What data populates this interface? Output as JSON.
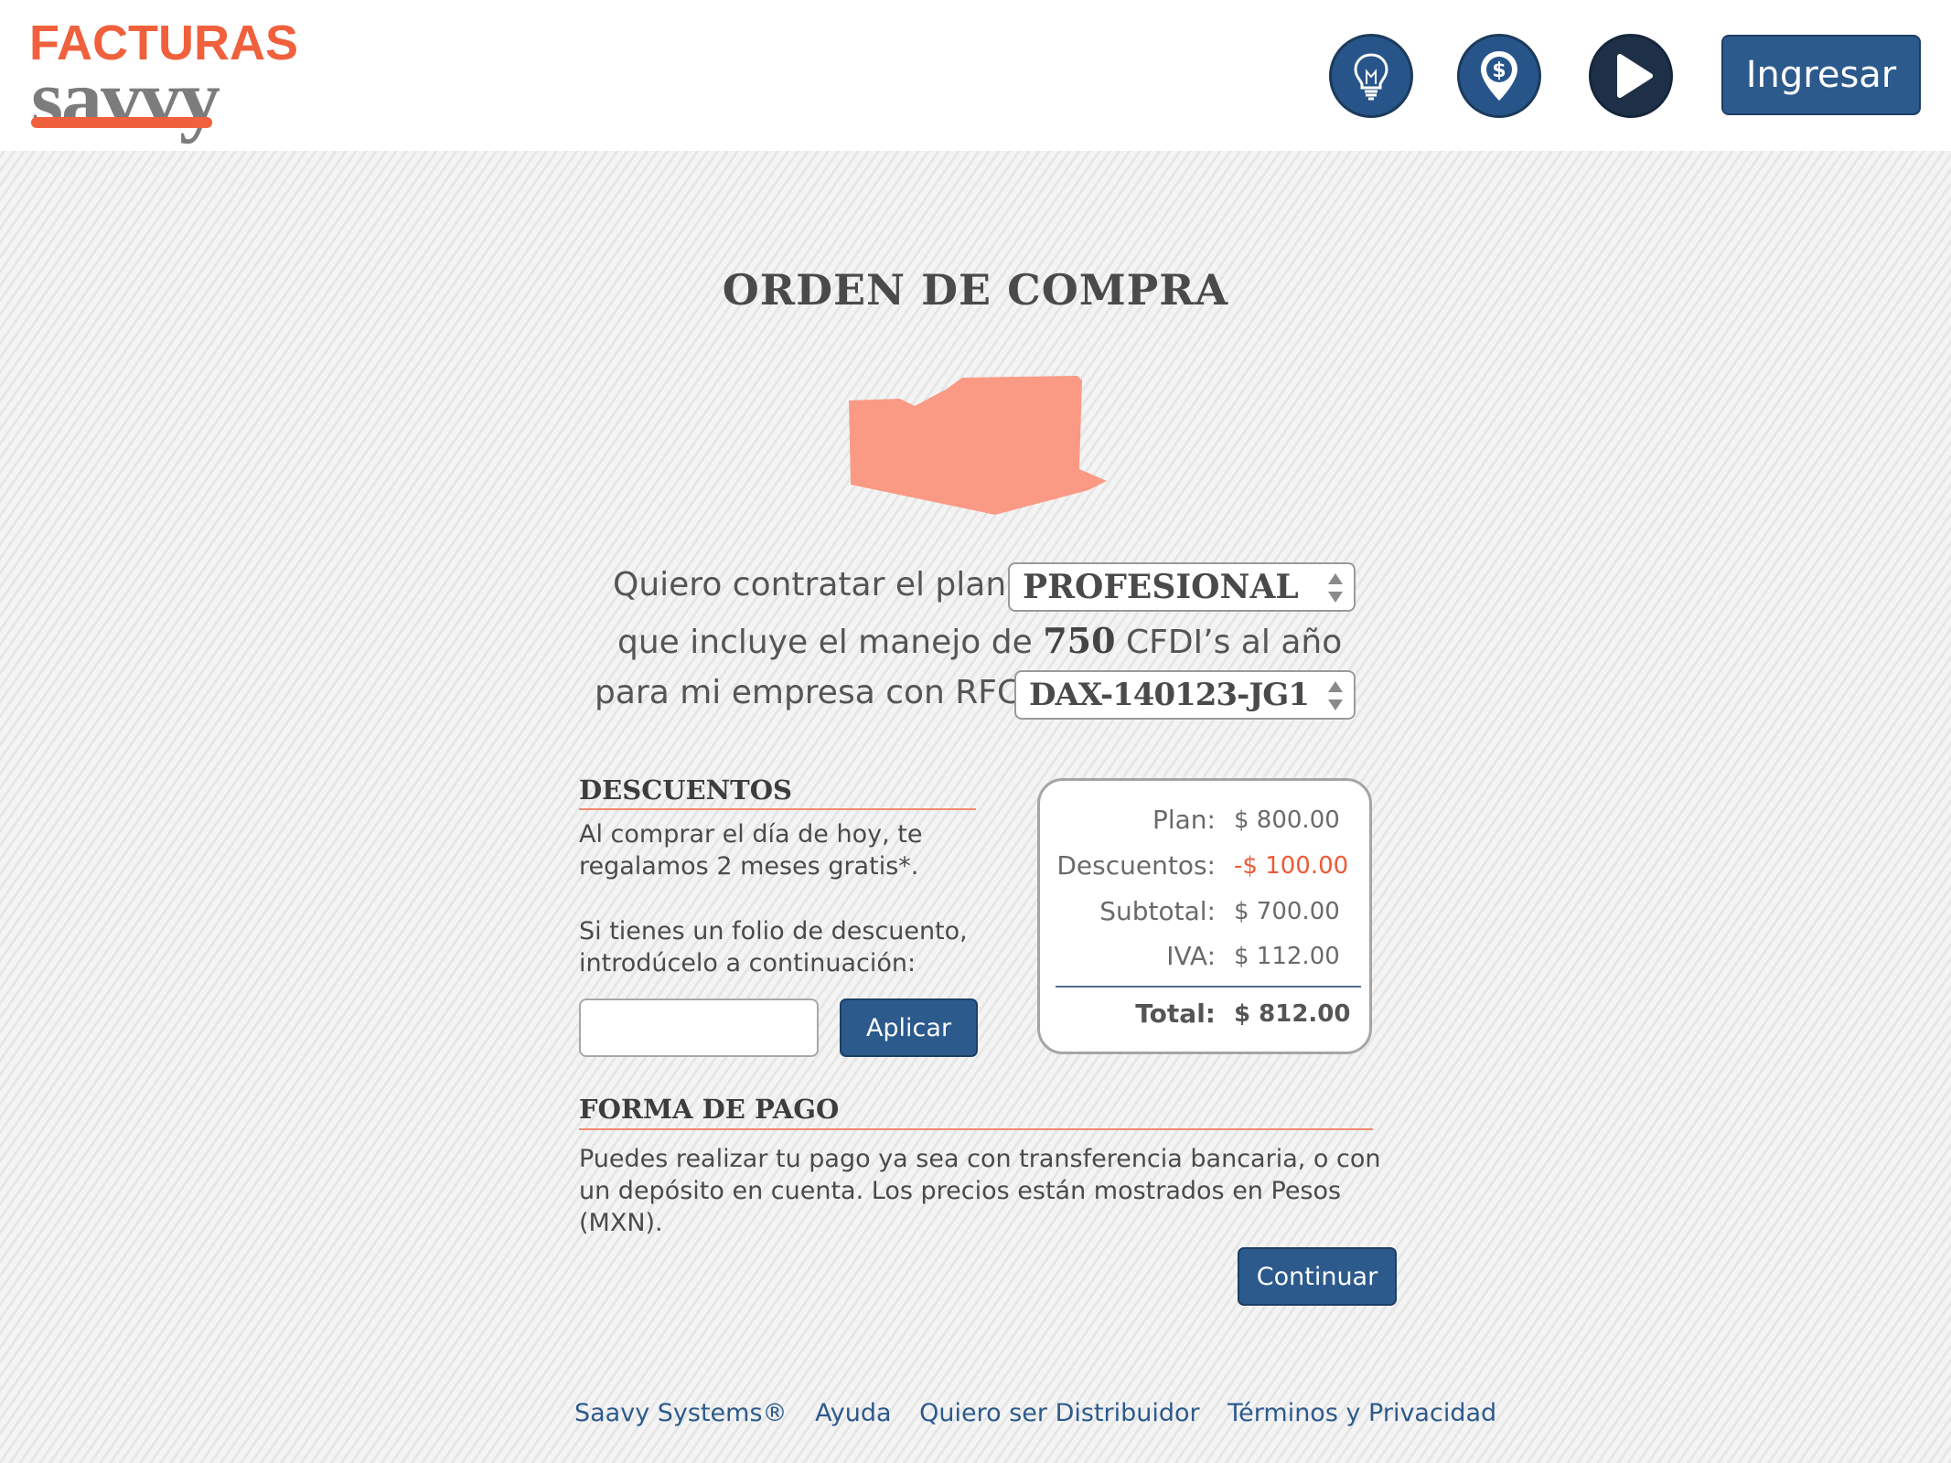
{
  "header": {
    "logo_top": "FACTURAS",
    "logo_bottom": "savvy",
    "icons": [
      {
        "name": "lightbulb-icon",
        "color": "#27558a"
      },
      {
        "name": "dollar-pin-icon",
        "color": "#27558a"
      },
      {
        "name": "play-icon",
        "color": "#1e3048"
      }
    ],
    "login_label": "Ingresar"
  },
  "main": {
    "title": "ORDEN DE COMPRA",
    "plan_sentence_prefix": "Quiero contratar el plan:",
    "plan_selected": "PROFESIONAL",
    "cfdi_prefix": "que incluye el manejo de",
    "cfdi_count": "750",
    "cfdi_suffix": "CFDI’s al año",
    "rfc_sentence_prefix": "para mi empresa con RFC:",
    "rfc_selected": "DAX-140123-JG1"
  },
  "discounts": {
    "title": "DESCUENTOS",
    "promo_text": "Al comprar el día de hoy, te regalamos 2 meses gratis*.",
    "folio_text": "Si tienes un folio de descuento, introdúcelo a continuación:",
    "folio_value": "",
    "apply_label": "Aplicar"
  },
  "summary": {
    "rows": [
      {
        "label": "Plan:",
        "value": "$ 800.00"
      },
      {
        "label": "Descuentos:",
        "value": "-$ 100.00"
      },
      {
        "label": "Subtotal:",
        "value": "$ 700.00"
      },
      {
        "label": "IVA:",
        "value": "$ 112.00"
      }
    ],
    "total_label": "Total:",
    "total_value": "$ 812.00"
  },
  "payment": {
    "title": "FORMA DE PAGO",
    "text": "Puedes realizar tu pago ya sea con transferencia bancaria, o con un depósito en cuenta. Los precios están mostrados en Pesos (MXN).",
    "continue_label": "Continuar"
  },
  "footer": {
    "links": [
      "Saavy Systems®",
      "Ayuda",
      "Quiero ser Distribuidor",
      "Términos y Privacidad"
    ]
  },
  "colors": {
    "accent": "#f0603c",
    "primary_blue": "#2c5a8c",
    "discount_red": "#ee5a36"
  }
}
